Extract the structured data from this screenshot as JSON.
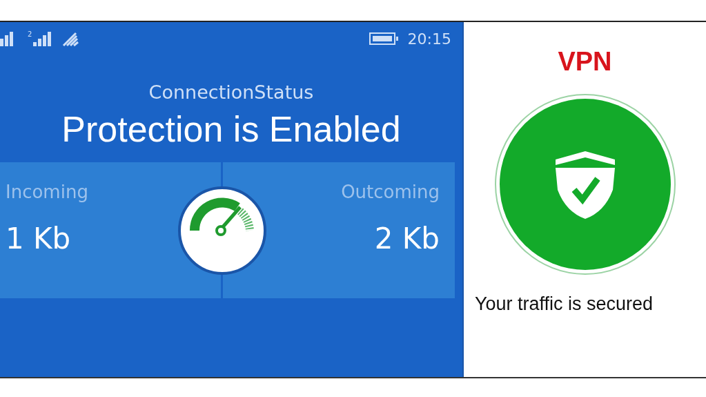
{
  "status_bar": {
    "sim_label": "2",
    "time": "20:15"
  },
  "connection": {
    "title": "ConnectionStatus",
    "headline": "Protection is Enabled"
  },
  "stats": [
    {
      "label": "Incoming",
      "value": "1 Kb"
    },
    {
      "label": "Outcoming",
      "value": "2 Kb"
    }
  ],
  "vpn": {
    "title": "VPN",
    "status": "Your traffic is secured"
  }
}
